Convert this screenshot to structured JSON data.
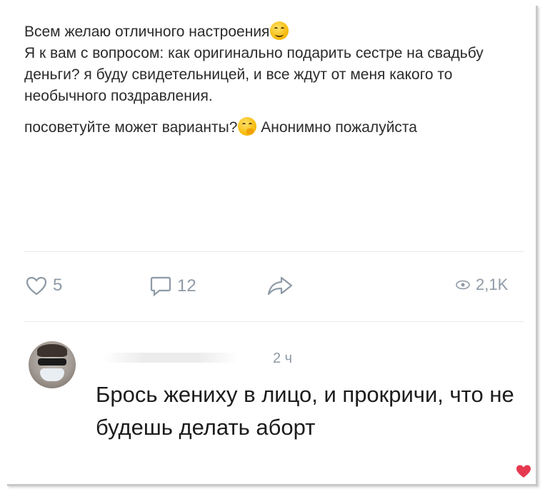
{
  "post": {
    "lines": [
      "Всем желаю отличного настроения",
      "Я к вам с вопросом: как оригинально подарить сестре на свадьбу деньги? я буду свидетельницей, и все ждут от меня какого то необычного поздравления.",
      "посоветуйте может варианты?",
      "Анонимно пожалуйста"
    ],
    "emoji_smile": "smiling-face-emoji",
    "emoji_thinking": "thinking-face-emoji"
  },
  "actions": {
    "likes": "5",
    "comments": "12",
    "views": "2,1K"
  },
  "comment": {
    "time": "2 ч",
    "text": "Брось жениху в лицо, и прокричи, что не будешь делать аборт",
    "liked_color": "#e63950"
  },
  "colors": {
    "icon": "#8e9aa6",
    "text": "#2b2b2b"
  }
}
